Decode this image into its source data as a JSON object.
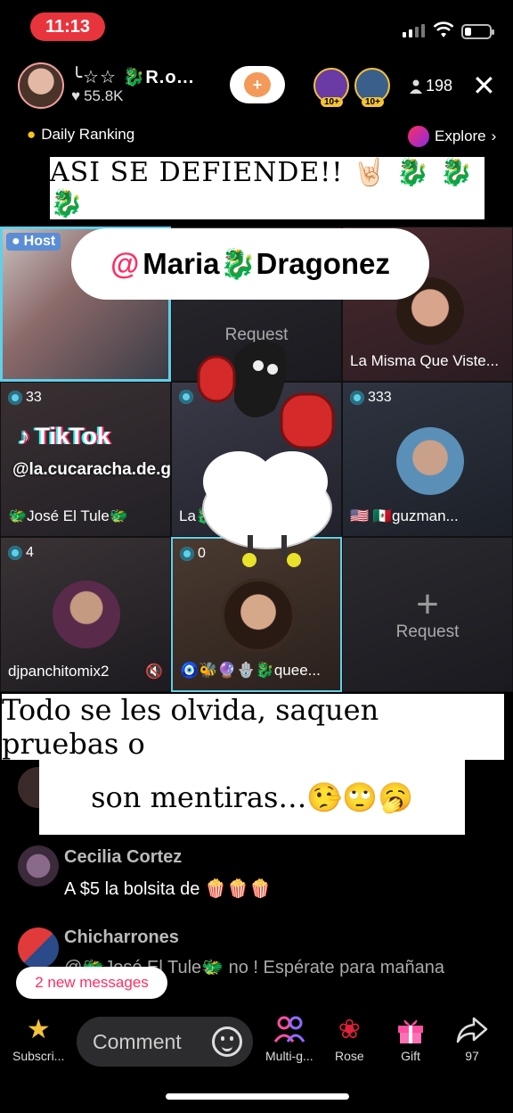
{
  "status_bar": {
    "time": "11:13"
  },
  "header": {
    "host_name": "╰☆☆ 🐉R.o...",
    "likes": "55.8K",
    "viewer_count": "198",
    "top_viewers": [
      {
        "badge": "10+",
        "color": "#6a3aa5"
      },
      {
        "badge": "10+",
        "color": "#3a5f8a"
      }
    ]
  },
  "ranking": {
    "daily_label": "Daily Ranking",
    "explore_label": "Explore"
  },
  "captions": {
    "top": "ASI SE DEFIENDE!! 🤘🏻 🐉 🐉 🐉",
    "mention_at": "@",
    "mention_name": "Maria🐉Dragonez",
    "bottom_line1": "Todo se les olvida, saquen pruebas o",
    "bottom_line2": "son mentiras…🤥🙄🥱"
  },
  "grid": {
    "host_tag": "Host",
    "request_label": "Request",
    "cells": [
      {
        "label": "La Misma Que Viste..."
      },
      {
        "count": "33",
        "label": "🐲José El Tule🐲"
      },
      {
        "count": "",
        "label": "La🐉Gu..."
      },
      {
        "count": "333",
        "label": "🇺🇸 🇲🇽guzman..."
      },
      {
        "count": "4",
        "label": "djpanchitomix2"
      },
      {
        "count": "0",
        "label": "🧿🐝🔮🪬🐉quee..."
      }
    ]
  },
  "watermark": {
    "brand": "TikTok",
    "handle": "@la.cucaracha.de.g"
  },
  "chat": [
    {
      "name": "Cecilia Cortez",
      "text": "A $5 la bolsita de 🍿🍿🍿"
    },
    {
      "name": "Chicharrones",
      "text": "@🐲José El Tule🐲 no ! Espérate para mañana"
    }
  ],
  "new_messages": "2 new messages",
  "bottom_bar": {
    "subscribe": "Subscri...",
    "comment_placeholder": "Comment",
    "multi_guest": "Multi-g...",
    "rose": "Rose",
    "gift": "Gift",
    "share_count": "97"
  }
}
